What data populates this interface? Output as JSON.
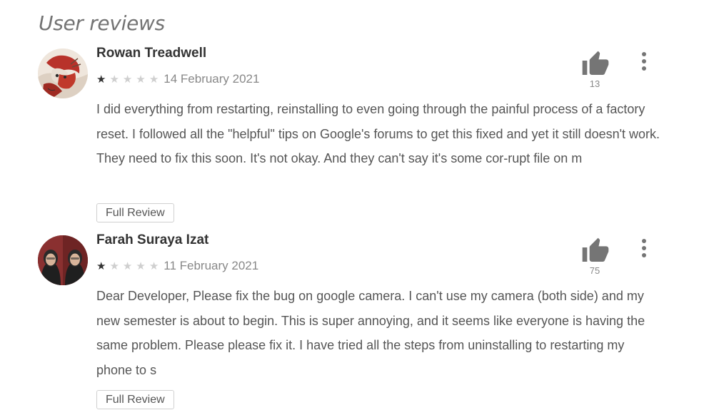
{
  "section": {
    "title": "User reviews"
  },
  "reviews": [
    {
      "author": "Rowan Treadwell",
      "rating": 1,
      "max_rating": 5,
      "date": "14 February 2021",
      "helpful_count": "13",
      "text": "I did everything from restarting, reinstalling to even going through the painful process of a factory reset. I followed all the \"helpful\" tips on Google's forums to get this fixed and yet it still doesn't work. They need to fix this soon. It's not okay. And they can't say it's some cor-rupt file on m",
      "full_review_label": "Full Review"
    },
    {
      "author": "Farah Suraya Izat",
      "rating": 1,
      "max_rating": 5,
      "date": "11 February 2021",
      "helpful_count": "75",
      "text": "Dear Developer, Please fix the bug on google camera. I can't use my camera (both side) and my new semester is about to begin. This is super annoying, and it seems like everyone is having the same problem. Please please fix it. I have tried all the steps from uninstalling to restarting my phone to s",
      "full_review_label": "Full Review"
    }
  ],
  "icons": {
    "helpful": "thumbs-up-icon",
    "more": "more-vertical-icon",
    "star": "star-icon"
  },
  "colors": {
    "star_filled": "#333333",
    "star_empty": "#cfcfcf",
    "icon_grey": "#757575",
    "meta_grey": "#888888",
    "body_text": "#555555"
  }
}
